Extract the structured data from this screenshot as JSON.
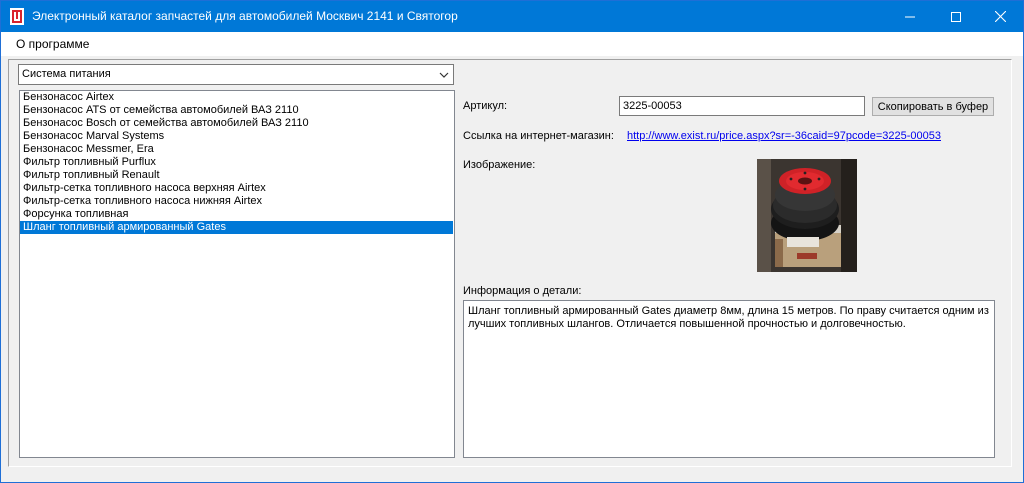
{
  "window": {
    "title": "Электронный каталог запчастей для автомобилей Москвич 2141 и Святогор",
    "icon": "catalog-app-icon",
    "accent_color": "#0078d7"
  },
  "menu": {
    "about": "О программе"
  },
  "category": {
    "selected": "Система питания"
  },
  "parts": [
    {
      "label": "Бензонасос Airtex"
    },
    {
      "label": "Бензонасос ATS от семейства автомобилей ВАЗ 2110"
    },
    {
      "label": "Бензонасос Bosch от семейства автомобилей ВАЗ 2110"
    },
    {
      "label": "Бензонасос Marval Systems"
    },
    {
      "label": "Бензонасос Messmer, Era"
    },
    {
      "label": "Фильтр топливный Purflux"
    },
    {
      "label": "Фильтр топливный Renault"
    },
    {
      "label": "Фильтр-сетка топливного насоса верхняя Airtex"
    },
    {
      "label": "Фильтр-сетка топливного насоса нижняя Airtex"
    },
    {
      "label": "Форсунка топливная"
    },
    {
      "label": "Шланг топливный армированный Gates",
      "selected": true
    }
  ],
  "details": {
    "article_label": "Артикул:",
    "article_value": "3225-00053",
    "copy_button": "Скопировать в буфер",
    "link_label": "Ссылка на интернет-магазин:",
    "link_url": "http://www.exist.ru/price.aspx?sr=-36caid=97pcode=3225-00053",
    "image_label": "Изображение:",
    "info_label": "Информация о детали:",
    "info_text": "Шланг топливный армированный Gates диаметр 8мм, длина 15 метров. По праву считается одним из лучших топливных шлангов. Отличается повышенной прочностью и долговечностью."
  }
}
